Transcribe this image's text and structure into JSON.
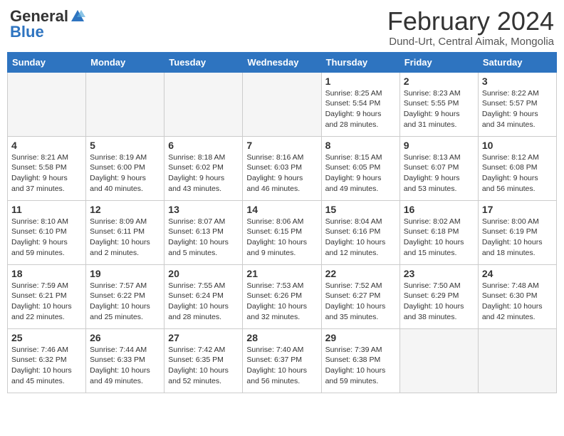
{
  "header": {
    "logo_general": "General",
    "logo_blue": "Blue",
    "month_title": "February 2024",
    "location": "Dund-Urt, Central Aimak, Mongolia"
  },
  "days_of_week": [
    "Sunday",
    "Monday",
    "Tuesday",
    "Wednesday",
    "Thursday",
    "Friday",
    "Saturday"
  ],
  "weeks": [
    [
      {
        "num": "",
        "info": "",
        "empty": true
      },
      {
        "num": "",
        "info": "",
        "empty": true
      },
      {
        "num": "",
        "info": "",
        "empty": true
      },
      {
        "num": "",
        "info": "",
        "empty": true
      },
      {
        "num": "1",
        "info": "Sunrise: 8:25 AM\nSunset: 5:54 PM\nDaylight: 9 hours\nand 28 minutes.",
        "empty": false
      },
      {
        "num": "2",
        "info": "Sunrise: 8:23 AM\nSunset: 5:55 PM\nDaylight: 9 hours\nand 31 minutes.",
        "empty": false
      },
      {
        "num": "3",
        "info": "Sunrise: 8:22 AM\nSunset: 5:57 PM\nDaylight: 9 hours\nand 34 minutes.",
        "empty": false
      }
    ],
    [
      {
        "num": "4",
        "info": "Sunrise: 8:21 AM\nSunset: 5:58 PM\nDaylight: 9 hours\nand 37 minutes.",
        "empty": false
      },
      {
        "num": "5",
        "info": "Sunrise: 8:19 AM\nSunset: 6:00 PM\nDaylight: 9 hours\nand 40 minutes.",
        "empty": false
      },
      {
        "num": "6",
        "info": "Sunrise: 8:18 AM\nSunset: 6:02 PM\nDaylight: 9 hours\nand 43 minutes.",
        "empty": false
      },
      {
        "num": "7",
        "info": "Sunrise: 8:16 AM\nSunset: 6:03 PM\nDaylight: 9 hours\nand 46 minutes.",
        "empty": false
      },
      {
        "num": "8",
        "info": "Sunrise: 8:15 AM\nSunset: 6:05 PM\nDaylight: 9 hours\nand 49 minutes.",
        "empty": false
      },
      {
        "num": "9",
        "info": "Sunrise: 8:13 AM\nSunset: 6:07 PM\nDaylight: 9 hours\nand 53 minutes.",
        "empty": false
      },
      {
        "num": "10",
        "info": "Sunrise: 8:12 AM\nSunset: 6:08 PM\nDaylight: 9 hours\nand 56 minutes.",
        "empty": false
      }
    ],
    [
      {
        "num": "11",
        "info": "Sunrise: 8:10 AM\nSunset: 6:10 PM\nDaylight: 9 hours\nand 59 minutes.",
        "empty": false
      },
      {
        "num": "12",
        "info": "Sunrise: 8:09 AM\nSunset: 6:11 PM\nDaylight: 10 hours\nand 2 minutes.",
        "empty": false
      },
      {
        "num": "13",
        "info": "Sunrise: 8:07 AM\nSunset: 6:13 PM\nDaylight: 10 hours\nand 5 minutes.",
        "empty": false
      },
      {
        "num": "14",
        "info": "Sunrise: 8:06 AM\nSunset: 6:15 PM\nDaylight: 10 hours\nand 9 minutes.",
        "empty": false
      },
      {
        "num": "15",
        "info": "Sunrise: 8:04 AM\nSunset: 6:16 PM\nDaylight: 10 hours\nand 12 minutes.",
        "empty": false
      },
      {
        "num": "16",
        "info": "Sunrise: 8:02 AM\nSunset: 6:18 PM\nDaylight: 10 hours\nand 15 minutes.",
        "empty": false
      },
      {
        "num": "17",
        "info": "Sunrise: 8:00 AM\nSunset: 6:19 PM\nDaylight: 10 hours\nand 18 minutes.",
        "empty": false
      }
    ],
    [
      {
        "num": "18",
        "info": "Sunrise: 7:59 AM\nSunset: 6:21 PM\nDaylight: 10 hours\nand 22 minutes.",
        "empty": false
      },
      {
        "num": "19",
        "info": "Sunrise: 7:57 AM\nSunset: 6:22 PM\nDaylight: 10 hours\nand 25 minutes.",
        "empty": false
      },
      {
        "num": "20",
        "info": "Sunrise: 7:55 AM\nSunset: 6:24 PM\nDaylight: 10 hours\nand 28 minutes.",
        "empty": false
      },
      {
        "num": "21",
        "info": "Sunrise: 7:53 AM\nSunset: 6:26 PM\nDaylight: 10 hours\nand 32 minutes.",
        "empty": false
      },
      {
        "num": "22",
        "info": "Sunrise: 7:52 AM\nSunset: 6:27 PM\nDaylight: 10 hours\nand 35 minutes.",
        "empty": false
      },
      {
        "num": "23",
        "info": "Sunrise: 7:50 AM\nSunset: 6:29 PM\nDaylight: 10 hours\nand 38 minutes.",
        "empty": false
      },
      {
        "num": "24",
        "info": "Sunrise: 7:48 AM\nSunset: 6:30 PM\nDaylight: 10 hours\nand 42 minutes.",
        "empty": false
      }
    ],
    [
      {
        "num": "25",
        "info": "Sunrise: 7:46 AM\nSunset: 6:32 PM\nDaylight: 10 hours\nand 45 minutes.",
        "empty": false
      },
      {
        "num": "26",
        "info": "Sunrise: 7:44 AM\nSunset: 6:33 PM\nDaylight: 10 hours\nand 49 minutes.",
        "empty": false
      },
      {
        "num": "27",
        "info": "Sunrise: 7:42 AM\nSunset: 6:35 PM\nDaylight: 10 hours\nand 52 minutes.",
        "empty": false
      },
      {
        "num": "28",
        "info": "Sunrise: 7:40 AM\nSunset: 6:37 PM\nDaylight: 10 hours\nand 56 minutes.",
        "empty": false
      },
      {
        "num": "29",
        "info": "Sunrise: 7:39 AM\nSunset: 6:38 PM\nDaylight: 10 hours\nand 59 minutes.",
        "empty": false
      },
      {
        "num": "",
        "info": "",
        "empty": true
      },
      {
        "num": "",
        "info": "",
        "empty": true
      }
    ]
  ]
}
